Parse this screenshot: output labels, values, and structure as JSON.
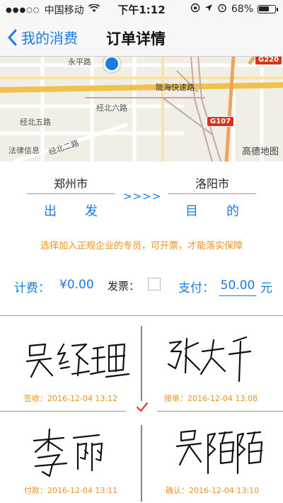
{
  "status_bar": {
    "carrier": "中国移动",
    "time": "下午1:12",
    "battery": "68%",
    "battery_level": 0.68
  },
  "navbar": {
    "back_label": "我的消费",
    "title": "订单详情"
  },
  "map": {
    "labels": [
      "永平路",
      "陇海快速路",
      "经北六路",
      "经北五路",
      "法律信息",
      "经北二路"
    ],
    "badges": [
      "G220",
      "G107"
    ],
    "provider": "高德地图"
  },
  "route": {
    "origin_city": "郑州市",
    "destination_city": "洛阳市",
    "origin_label": "出发",
    "destination_label": "目的",
    "arrows": ">>>>"
  },
  "notice": "选择加入正规企业的专员，可开票，才能落实保障",
  "fee": {
    "fee_label": "计费：",
    "fee_value": "¥0.00",
    "invoice_label": "发票：",
    "invoice_checked": false,
    "pay_label": "支付：",
    "pay_value": "50.00",
    "unit": "元"
  },
  "signatures": [
    {
      "name": "吴经理",
      "caption": "签收：2016-12-04 13:12"
    },
    {
      "name": "张大千",
      "caption": "接单：2016-12-04 13:08"
    },
    {
      "name": "李丽",
      "caption": "付款：2016-12-04 13:11"
    },
    {
      "name": "吴陌陌",
      "caption": "确认：2016-12-04 13:10"
    }
  ],
  "colors": {
    "accent": "#1a7be0",
    "orange": "#f0921f",
    "check": "#e03a3a"
  }
}
